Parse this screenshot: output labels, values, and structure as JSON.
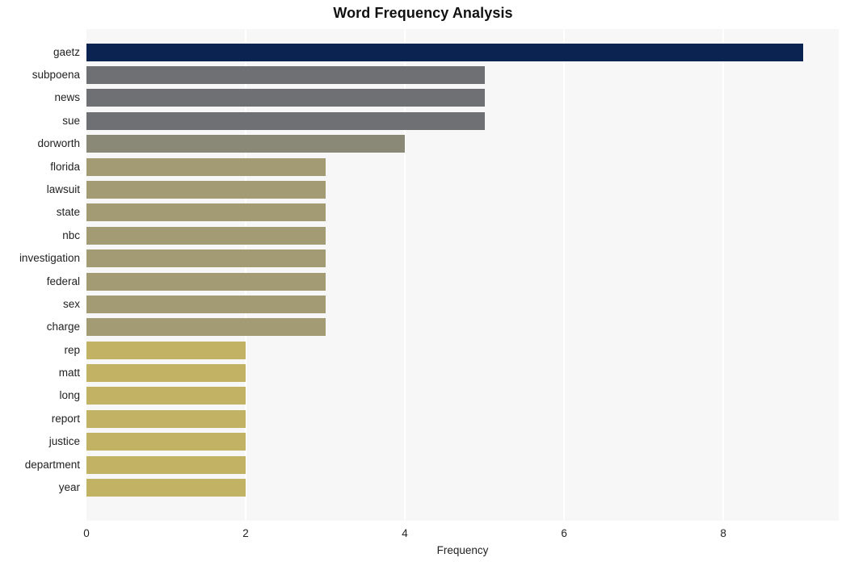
{
  "chart_data": {
    "type": "bar",
    "orientation": "horizontal",
    "title": "Word Frequency Analysis",
    "xlabel": "Frequency",
    "ylabel": "",
    "xlim": [
      0,
      9.45
    ],
    "xticks": [
      0,
      2,
      4,
      6,
      8
    ],
    "xtick_labels": [
      "0",
      "2",
      "4",
      "6",
      "8"
    ],
    "grid": "vertical-only",
    "legend": "none",
    "categories": [
      "gaetz",
      "subpoena",
      "news",
      "sue",
      "dorworth",
      "florida",
      "lawsuit",
      "state",
      "nbc",
      "investigation",
      "federal",
      "sex",
      "charge",
      "rep",
      "matt",
      "long",
      "report",
      "justice",
      "department",
      "year"
    ],
    "values": [
      9,
      5,
      5,
      5,
      4,
      3,
      3,
      3,
      3,
      3,
      3,
      3,
      3,
      2,
      2,
      2,
      2,
      2,
      2,
      2
    ],
    "bar_colors": [
      "#0a2350",
      "#6e7073",
      "#6e7073",
      "#6e7073",
      "#8a8877",
      "#a39b74",
      "#a39b74",
      "#a39b74",
      "#a39b74",
      "#a39b74",
      "#a39b74",
      "#a39b74",
      "#a39b74",
      "#c2b264",
      "#c2b264",
      "#c2b264",
      "#c2b264",
      "#c2b264",
      "#c2b264",
      "#c2b264"
    ],
    "plot_background": "#f7f7f7",
    "gridline_color": "#ffffff",
    "figure_background": "#ffffff"
  }
}
